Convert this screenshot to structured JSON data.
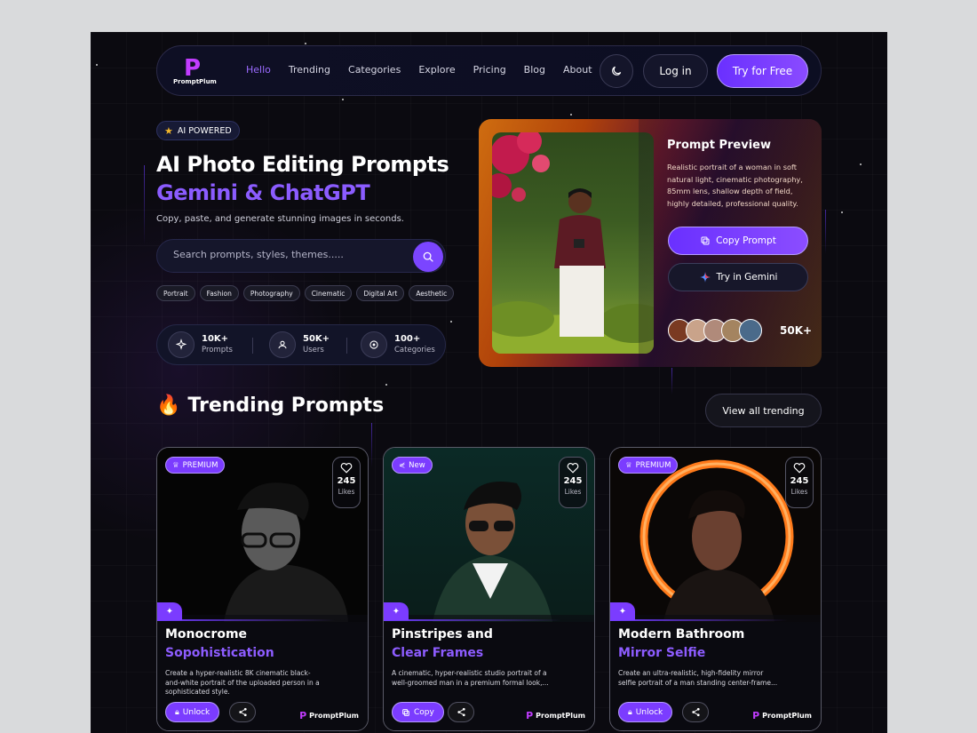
{
  "nav": {
    "logo_letter": "P",
    "logo_text": "PromptPlum",
    "links": [
      "Hello",
      "Trending",
      "Categories",
      "Explore",
      "Pricing",
      "Blog",
      "About"
    ],
    "active_link": "Hello",
    "login_label": "Log in",
    "cta_label": "Try for Free"
  },
  "hero": {
    "badge": "AI POWERED",
    "title_line1": "AI Photo Editing Prompts",
    "title_line2": "Gemini & ChatGPT",
    "subtitle": "Copy, paste, and generate stunning images in seconds.",
    "search_placeholder": "Search prompts, styles, themes.....",
    "tags": [
      "Portrait",
      "Fashion",
      "Photography",
      "Cinematic",
      "Digital Art",
      "Aesthetic"
    ],
    "stats": [
      {
        "value": "10K+",
        "label": "Prompts",
        "icon": "sparkle-icon"
      },
      {
        "value": "50K+",
        "label": "Users",
        "icon": "users-icon"
      },
      {
        "value": "100+",
        "label": "Categories",
        "icon": "target-icon"
      }
    ]
  },
  "preview": {
    "title": "Prompt Preview",
    "text": "Realistic portrait of a woman in soft natural light, cinematic photography, 85mm lens, shallow depth of field, highly detailed, professional quality.",
    "copy_label": "Copy Prompt",
    "gemini_label": "Try in Gemini",
    "count": "50K+"
  },
  "trending": {
    "title": "Trending Prompts",
    "emoji": "🔥",
    "view_all": "View all trending",
    "cards": [
      {
        "tag": "PREMIUM",
        "likes": "245",
        "likes_label": "Likes",
        "title1": "Monocrome",
        "title2": "Sopohistication",
        "desc": "Create a hyper-realistic 8K cinematic black-and-white portrait of the uploaded person in a sophisticated style.",
        "action": "Unlock",
        "brand": "PromptPlum"
      },
      {
        "tag": "New",
        "likes": "245",
        "likes_label": "Likes",
        "title1": "Pinstripes and",
        "title2": "Clear Frames",
        "desc": "A cinematic, hyper-realistic studio portrait of a well-groomed man in a premium formal look,...",
        "action": "Copy",
        "brand": "PromptPlum"
      },
      {
        "tag": "PREMIUM",
        "likes": "245",
        "likes_label": "Likes",
        "title1": "Modern Bathroom",
        "title2": "Mirror Selfie",
        "desc": "Create an ultra-realistic, high-fidelity mirror selfie portrait of a man standing center-frame...",
        "action": "Unlock",
        "brand": "PromptPlum"
      }
    ]
  },
  "colors": {
    "accent": "#7b3cff",
    "accent_text": "#8b5cff",
    "background": "#0b0a10"
  }
}
